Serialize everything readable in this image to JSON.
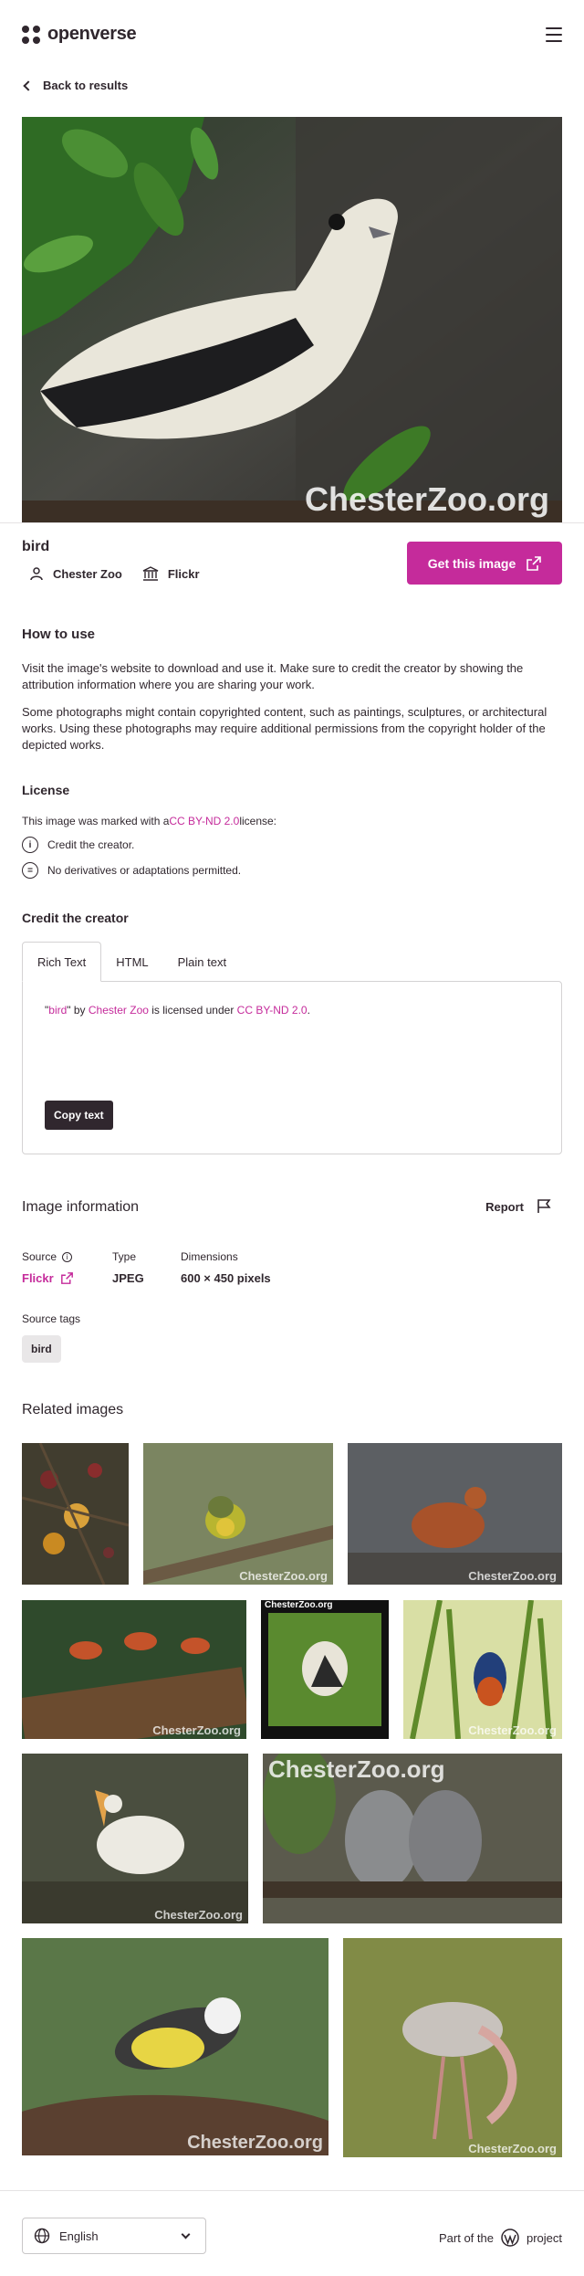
{
  "header": {
    "logo_text": "openverse",
    "menu_icon": "hamburger-menu-icon"
  },
  "nav": {
    "back_label": "Back to results"
  },
  "image": {
    "watermark": "ChesterZoo.org",
    "title": "bird",
    "creator": "Chester Zoo",
    "source": "Flickr",
    "get_button": "Get this image"
  },
  "how_to_use": {
    "heading": "How to use",
    "p1": "Visit the image's website to download and use it. Make sure to credit the creator by showing the attribution information where you are sharing your work.",
    "p2": "Some photographs might contain copyrighted content, such as paintings, sculptures, or architectural works. Using these photographs may require additional permissions from the copyright holder of the depicted works."
  },
  "license": {
    "heading": "License",
    "intro_prefix": "This image was marked with a ",
    "license_name": "CC BY-ND 2.0",
    "intro_suffix": " license:",
    "item1": "Credit the creator.",
    "item2": "No derivatives or adaptations permitted."
  },
  "credit": {
    "heading": "Credit the creator",
    "tabs": [
      "Rich Text",
      "HTML",
      "Plain text"
    ],
    "q_open": "\"",
    "title_link": "bird",
    "q_close": "\" by ",
    "creator_link": "Chester Zoo",
    "mid": " is licensed under ",
    "license_link": "CC BY-ND 2.0",
    "end": ".",
    "copy_button": "Copy text"
  },
  "info": {
    "heading": "Image information",
    "report": "Report",
    "source_label": "Source",
    "source_value": "Flickr",
    "type_label": "Type",
    "type_value": "JPEG",
    "dim_label": "Dimensions",
    "dim_value": "600 × 450 pixels",
    "tags_label": "Source tags",
    "tag": "bird"
  },
  "related": {
    "heading": "Related images",
    "watermark": "ChesterZoo.org"
  },
  "footer": {
    "language": "English",
    "part_of_prefix": "Part of the",
    "part_of_suffix": "project"
  },
  "colors": {
    "accent": "#c52b9b",
    "text": "#30272e"
  }
}
